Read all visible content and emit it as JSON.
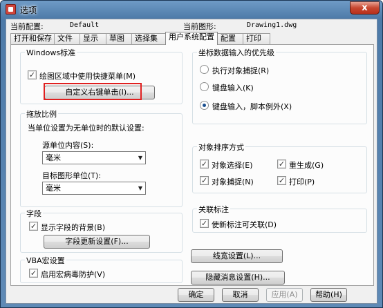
{
  "window": {
    "title": "选项",
    "close_glyph": "x",
    "current_profile_label": "当前配置:",
    "current_profile_value": "Default",
    "current_drawing_label": "当前图形:",
    "current_drawing_value": "Drawing1.dwg"
  },
  "tabs": [
    "打开和保存",
    "文件",
    "显示",
    "草图",
    "选择集",
    "用户系统配置",
    "配置",
    "打印"
  ],
  "windows_standard": {
    "title": "Windows标准",
    "shortcut_menu_label": "绘图区域中使用快捷菜单(M)",
    "shortcut_menu_checked": true,
    "custom_right_click_button": "自定义右键单击(I)..."
  },
  "drag_scale": {
    "title": "拖放比例",
    "description": "当单位设置为无单位时的默认设置:",
    "source_label": "源单位内容(S):",
    "source_value": "毫米",
    "target_label": "目标图形单位(T):",
    "target_value": "毫米"
  },
  "field": {
    "title": "字段",
    "show_background_label": "显示字段的背景(B)",
    "show_background_checked": true,
    "update_settings_button": "字段更新设置(F)..."
  },
  "vba": {
    "title": "VBA宏设置",
    "virus_protection_label": "启用宏病毒防护(V)",
    "virus_protection_checked": true
  },
  "coord_priority": {
    "title": "坐标数据输入的优先级",
    "options": [
      "执行对象捕捉(R)",
      "键盘输入(K)",
      "键盘输入，脚本例外(X)"
    ],
    "selected_index": 2
  },
  "object_sort": {
    "title": "对象排序方式",
    "items": [
      {
        "label": "对象选择(E)",
        "checked": true
      },
      {
        "label": "重生成(G)",
        "checked": true
      },
      {
        "label": "对象捕捉(N)",
        "checked": true
      },
      {
        "label": "打印(P)",
        "checked": true
      }
    ]
  },
  "assoc_dim": {
    "title": "关联标注",
    "new_dims_assoc_label": "使新标注可关联(D)",
    "new_dims_assoc_checked": true
  },
  "buttons": {
    "lineweight_settings": "线宽设置(L)...",
    "hidden_messages_settings": "隐藏消息设置(H)...",
    "ok": "确定",
    "cancel": "取消",
    "apply": "应用(A)",
    "help": "帮助(H)"
  },
  "check_glyph": "✓"
}
